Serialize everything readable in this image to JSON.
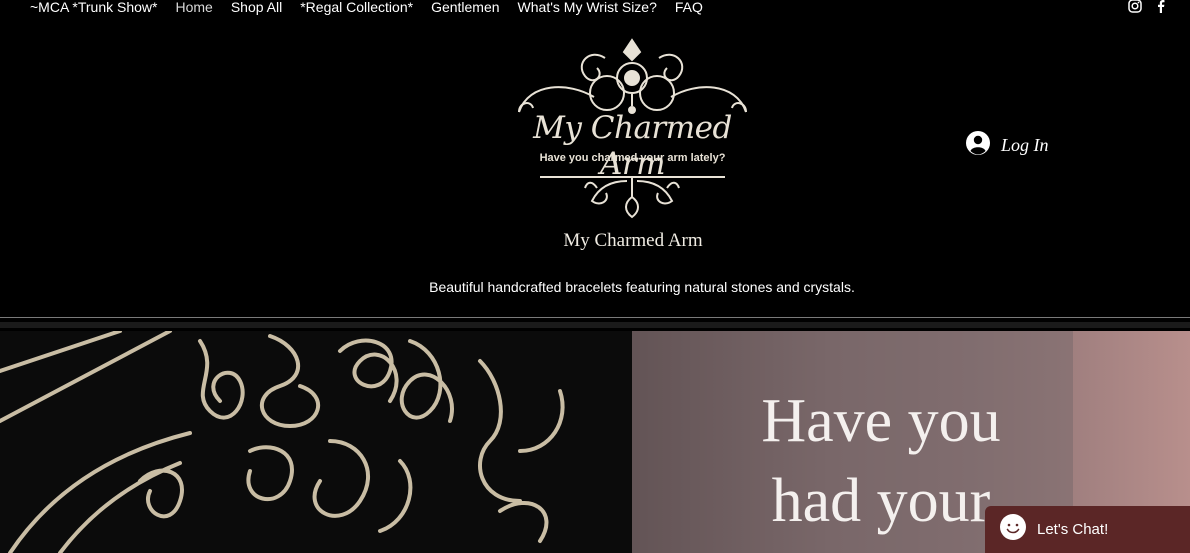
{
  "nav": {
    "items": [
      {
        "label": "~MCA *Trunk Show*"
      },
      {
        "label": "Home"
      },
      {
        "label": "Shop All"
      },
      {
        "label": "*Regal Collection*"
      },
      {
        "label": "Gentlemen"
      },
      {
        "label": "What's My Wrist Size?"
      },
      {
        "label": "FAQ"
      }
    ]
  },
  "social": [
    "instagram-icon",
    "facebook-icon"
  ],
  "logo": {
    "name": "My Charmed Arm",
    "tagline": "Have you charmed your arm lately?"
  },
  "site": {
    "title": "My Charmed Arm",
    "subtitle": "Beautiful handcrafted bracelets featuring natural stones and crystals."
  },
  "login": {
    "label": "Log In"
  },
  "hero": {
    "heading_line1": "Have you",
    "heading_line2": "had your"
  },
  "chat": {
    "label": "Let's Chat!"
  },
  "colors": {
    "background": "#000000",
    "chat": "#5b2626",
    "logo_gold": "#e8e2d6"
  }
}
